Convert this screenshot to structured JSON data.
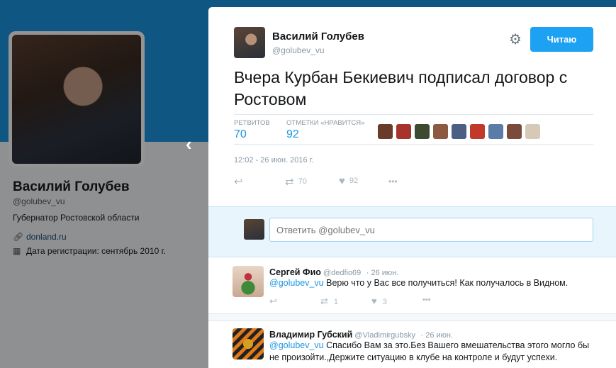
{
  "profile": {
    "name": "Василий Голубев",
    "handle": "@golubev_vu",
    "bio": "Губернатор Ростовской области",
    "link_icon": "link-icon",
    "link": "donland.ru",
    "join_icon": "calendar-icon",
    "join_date": "Дата регистрации: сентябрь 2010 г."
  },
  "nav": {
    "prev_glyph": "‹"
  },
  "tweet": {
    "author_name": "Василий Голубев",
    "author_handle": "@golubev_vu",
    "gear_glyph": "⚙",
    "follow_label": "Читаю",
    "text": "Вчера Курбан Бекиевич подписал договор с Ростовом",
    "retweets_label": "РЕТВИТОВ",
    "retweets_count": "70",
    "likes_label": "ОТМЕТКИ «НРАВИТСЯ»",
    "likes_count": "92",
    "timestamp": "12:02 - 26 июн. 2016 г.",
    "action_reply_glyph": "↩",
    "action_retweet_glyph": "⇄",
    "action_retweet_count": "70",
    "action_like_glyph": "♥",
    "action_like_count": "92",
    "action_more_glyph": "•••"
  },
  "likers_colors": [
    "#6b3b2a",
    "#a8322c",
    "#3e4a2f",
    "#8c5a40",
    "#4b5f84",
    "#c0392b",
    "#5a7ca6",
    "#7c4a3a",
    "#d6c9b8"
  ],
  "reply_box": {
    "placeholder": "Ответить @golubev_vu"
  },
  "replies": [
    {
      "name": "Сергей Фио",
      "handle": "@dedfio69",
      "time": "· 26 июн.",
      "mention": "@golubev_vu",
      "text": " Верю что у Вас все получиться! Как получалось в Видном.",
      "reply_glyph": "↩",
      "retweet_glyph": "⇄",
      "retweet_count": "1",
      "like_glyph": "♥",
      "like_count": "3",
      "more_glyph": "•••"
    },
    {
      "name": "Владимир Губский",
      "handle": "@Vladimirgubsky",
      "time": "· 26 июн.",
      "mention": "@golubev_vu",
      "text": " Спасибо Вам за это.Без Вашего вмешательства этого могло бы не произойти.,Держите ситуацию в клубе на контроле и будут успехи."
    }
  ],
  "colors": {
    "accent": "#1da1f2",
    "link": "#1b95e0",
    "header": "#1b95e0"
  }
}
